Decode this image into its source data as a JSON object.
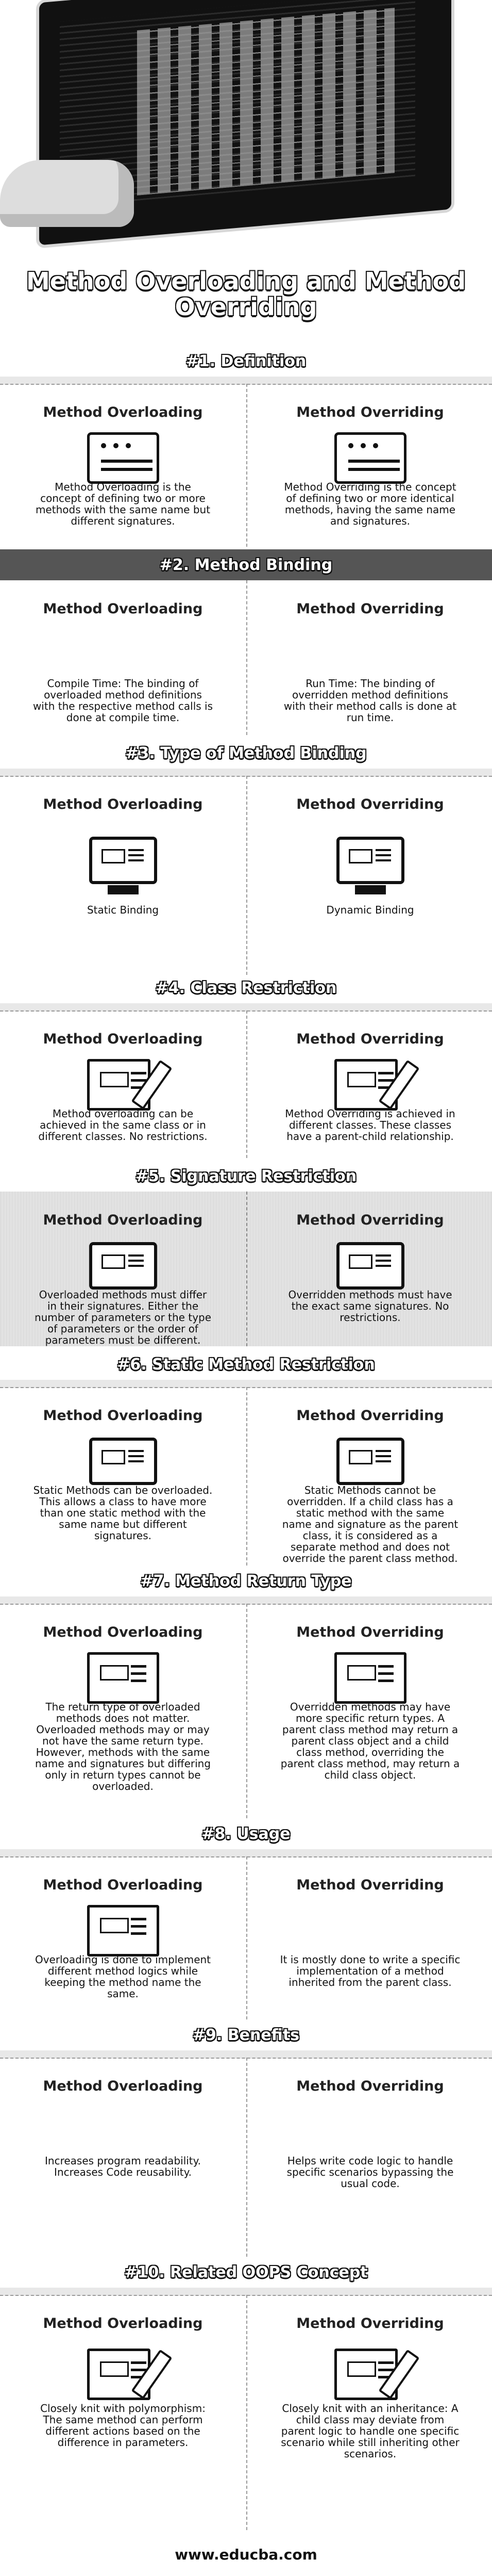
{
  "main_title": "Method Overloading and Method Overriding",
  "footer": "www.educba.com",
  "sections": [
    {
      "title": "#1. Definition",
      "left_heading": "Method Overloading",
      "right_heading": "Method Overriding",
      "left_text": "Method Overloading is the concept of defining two or more methods with the same name but different signatures.",
      "right_text": "Method Overriding is the concept of defining two or more identical methods, having the same name and signatures."
    },
    {
      "title": "#2. Method Binding",
      "left_heading": "Method Overloading",
      "right_heading": "Method Overriding",
      "left_text": "Compile Time: The binding of overloaded method definitions with the respective method calls is done at compile time.",
      "right_text": "Run Time: The binding of overridden method definitions with their method calls is done at run time."
    },
    {
      "title": "#3. Type of Method Binding",
      "left_heading": "Method Overloading",
      "right_heading": "Method Overriding",
      "left_text": "Static Binding",
      "right_text": "Dynamic Binding"
    },
    {
      "title": "#4. Class Restriction",
      "left_heading": "Method Overloading",
      "right_heading": "Method Overriding",
      "left_text": "Method overloading can be achieved in the same class or in different classes. No restrictions.",
      "right_text": "Method Overriding is achieved in different classes. These classes have a parent-child relationship."
    },
    {
      "title": "#5. Signature Restriction",
      "left_heading": "Method Overloading",
      "right_heading": "Method Overriding",
      "left_text": "Overloaded methods must differ in their signatures. Either the number of parameters or the type of parameters or the order of parameters must be different.",
      "right_text": "Overridden methods must have the exact same signatures. No restrictions."
    },
    {
      "title": "#6. Static Method Restriction",
      "left_heading": "Method Overloading",
      "right_heading": "Method Overriding",
      "left_text": "Static Methods can be overloaded. This allows a class to have more than one static method with the same name but different signatures.",
      "right_text": "Static Methods cannot be overridden. If a child class has a static method with the same name and signature as the parent class, it is considered as a separate method and does not override the parent class method."
    },
    {
      "title": "#7. Method Return Type",
      "left_heading": "Method Overloading",
      "right_heading": "Method Overriding",
      "left_text": "The return type of overloaded methods does not matter. Overloaded methods may or may not have the same return type. However, methods with the same name and signatures but differing only in return types cannot be overloaded.",
      "right_text": "Overridden methods may have more specific return types. A parent class method may return a parent class object and a child class method, overriding the parent class method, may return a child class object."
    },
    {
      "title": "#8. Usage",
      "left_heading": "Method Overloading",
      "right_heading": "Method Overriding",
      "left_text": "Overloading is done to implement different method logics while keeping the method name the same.",
      "right_text": "It is mostly done to write a specific implementation of a method inherited from the parent class."
    },
    {
      "title": "#9. Benefits",
      "left_heading": "Method Overloading",
      "right_heading": "Method Overriding",
      "left_text": "Increases program readability. Increases Code reusability.",
      "right_text": "Helps write code logic to handle specific scenarios bypassing the usual code."
    },
    {
      "title": "#10. Related OOPS Concept",
      "left_heading": "Method Overloading",
      "right_heading": "Method Overriding",
      "left_text": "Closely knit with polymorphism: The same method can perform different actions based on the difference in parameters.",
      "right_text": "Closely knit with an inheritance: A child class may deviate from parent logic to handle one specific scenario while still inheriting other scenarios."
    }
  ]
}
